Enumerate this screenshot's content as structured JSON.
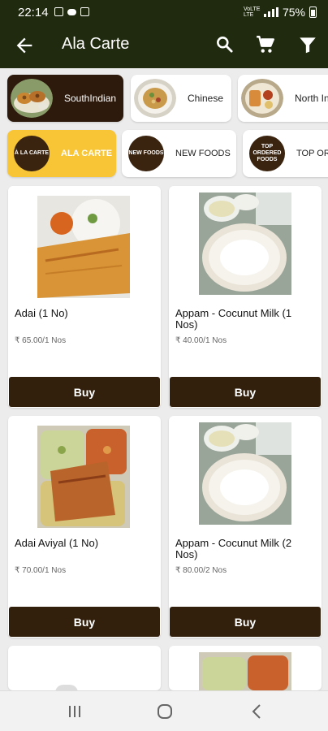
{
  "status_bar": {
    "time": "22:14",
    "network": "VoLTE LTE",
    "battery": "75%"
  },
  "app_bar": {
    "title": "Ala Carte"
  },
  "category_row_1": [
    {
      "label": "SouthIndian"
    },
    {
      "label": "Chinese"
    },
    {
      "label": "North In"
    }
  ],
  "category_row_2": [
    {
      "label": "ALA CARTE",
      "badge": "À LA CARTE"
    },
    {
      "label": "NEW FOODS",
      "badge": "NEW FOODS"
    },
    {
      "label": "TOP OR",
      "badge": "TOP ORDERED FOODS"
    }
  ],
  "products": [
    {
      "name": "Adai (1 No)",
      "price": "₹ 65.00/1 Nos",
      "buy_label": "Buy"
    },
    {
      "name": "Appam - Cocunut Milk (1 Nos)",
      "price": "₹ 40.00/1 Nos",
      "buy_label": "Buy"
    },
    {
      "name": "Adai Aviyal (1 No)",
      "price": "₹ 70.00/1 Nos",
      "buy_label": "Buy"
    },
    {
      "name": "Appam - Cocunut Milk (2 Nos)",
      "price": "₹ 80.00/2 Nos",
      "buy_label": "Buy"
    }
  ],
  "colors": {
    "app_bar": "#1f2a0e",
    "chip_selected": "#2d1a0c",
    "chip_highlight": "#f7c535",
    "buy_button": "#33200c"
  }
}
